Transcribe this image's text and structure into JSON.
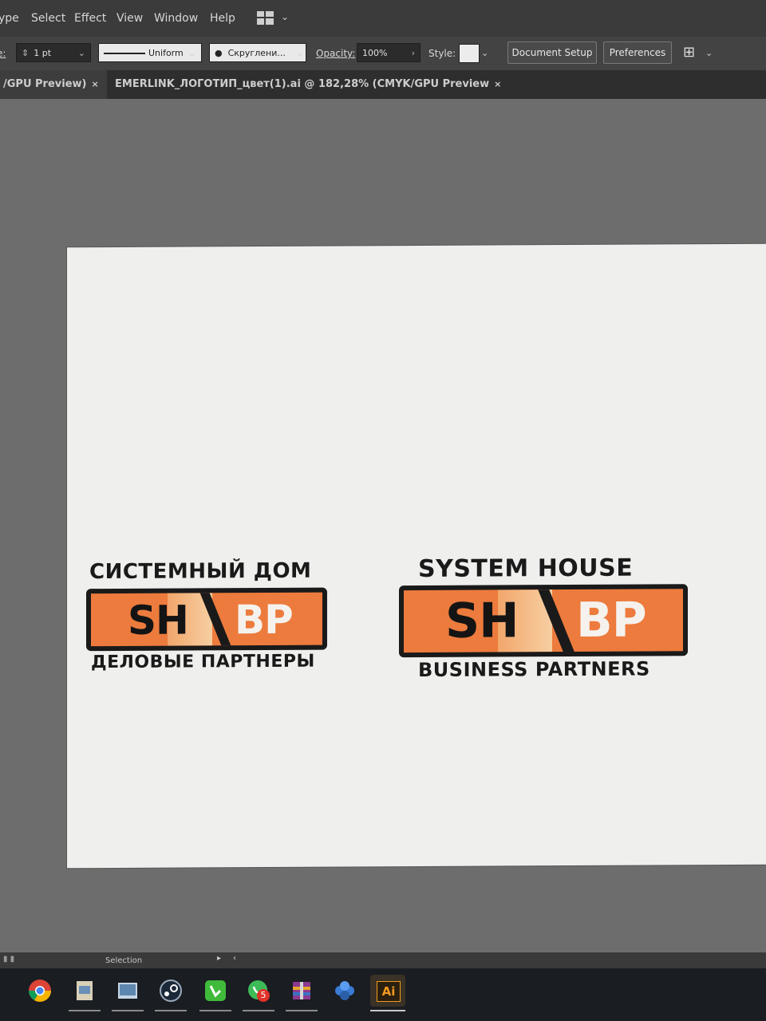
{
  "menubar": {
    "items": [
      "ype",
      "Select",
      "Effect",
      "View",
      "Window",
      "Help"
    ]
  },
  "control_bar": {
    "stroke_label": "e:",
    "stroke_weight": "1 pt",
    "profile": "Uniform",
    "brush": "Скруглени...",
    "opacity_label": "Opacity:",
    "opacity_value": "100%",
    "style_label": "Style:",
    "document_setup": "Document Setup",
    "preferences": "Preferences"
  },
  "tabs": [
    {
      "label": "/GPU Preview)",
      "active": true
    },
    {
      "label": "EMERLINK_ЛОГОТИП_цвет(1).ai @ 182,28% (CMYK/GPU Preview",
      "active": false
    }
  ],
  "tab_close_glyph": "×",
  "logos": {
    "ru": {
      "top": "СИСТЕМНЫЙ ДОМ",
      "left": "SH",
      "right": "BP",
      "bottom": "ДЕЛОВЫЕ ПАРТНЕРЫ"
    },
    "en": {
      "top": "SYSTEM HOUSE",
      "left": "SH",
      "right": "BP",
      "bottom": "BUSINESS PARTNERS"
    }
  },
  "status": {
    "tool": "Selection"
  },
  "taskbar": {
    "items": [
      "chrome-icon",
      "file-icon",
      "image-icon",
      "steam-icon",
      "phone-icon",
      "whatsapp-icon",
      "archive-icon",
      "app-icon",
      "illustrator-icon"
    ],
    "whatsapp_badge": "5",
    "illustrator_label": "Ai"
  },
  "colors": {
    "logo_orange": "#ec7b3d",
    "logo_dark": "#1a1a1a",
    "illustrator": "#f29a1f"
  }
}
